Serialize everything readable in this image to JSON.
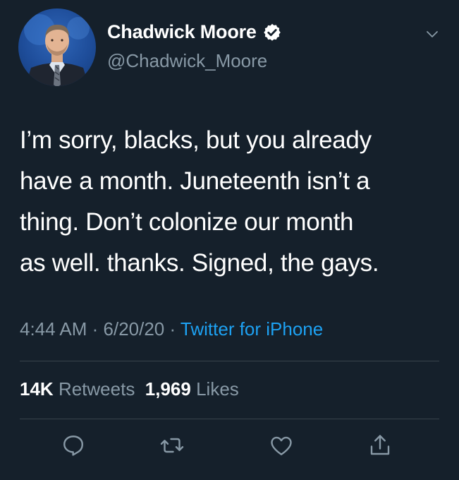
{
  "author": {
    "display_name": "Chadwick Moore",
    "handle": "@Chadwick_Moore",
    "verified": true,
    "verified_color": "#ffffff"
  },
  "tweet": {
    "text": "I’m sorry, blacks, but you already\nhave a month. Juneteenth isn’t a\nthing. Don’t colonize our month\nas well. thanks. Signed, the gays.",
    "time": "4:44 AM",
    "separator1": " · ",
    "date": "6/20/20",
    "separator2": " · ",
    "source": "Twitter for iPhone"
  },
  "stats": {
    "retweets_count": "14K",
    "retweets_label": "Retweets",
    "likes_count": "1,969",
    "likes_label": "Likes"
  },
  "actions": {
    "icons": [
      "reply-icon",
      "retweet-icon",
      "like-icon",
      "share-icon"
    ]
  },
  "colors": {
    "background": "#15202b",
    "secondary_text": "#8899a6",
    "link": "#1da1f2",
    "divider": "#38444d"
  }
}
